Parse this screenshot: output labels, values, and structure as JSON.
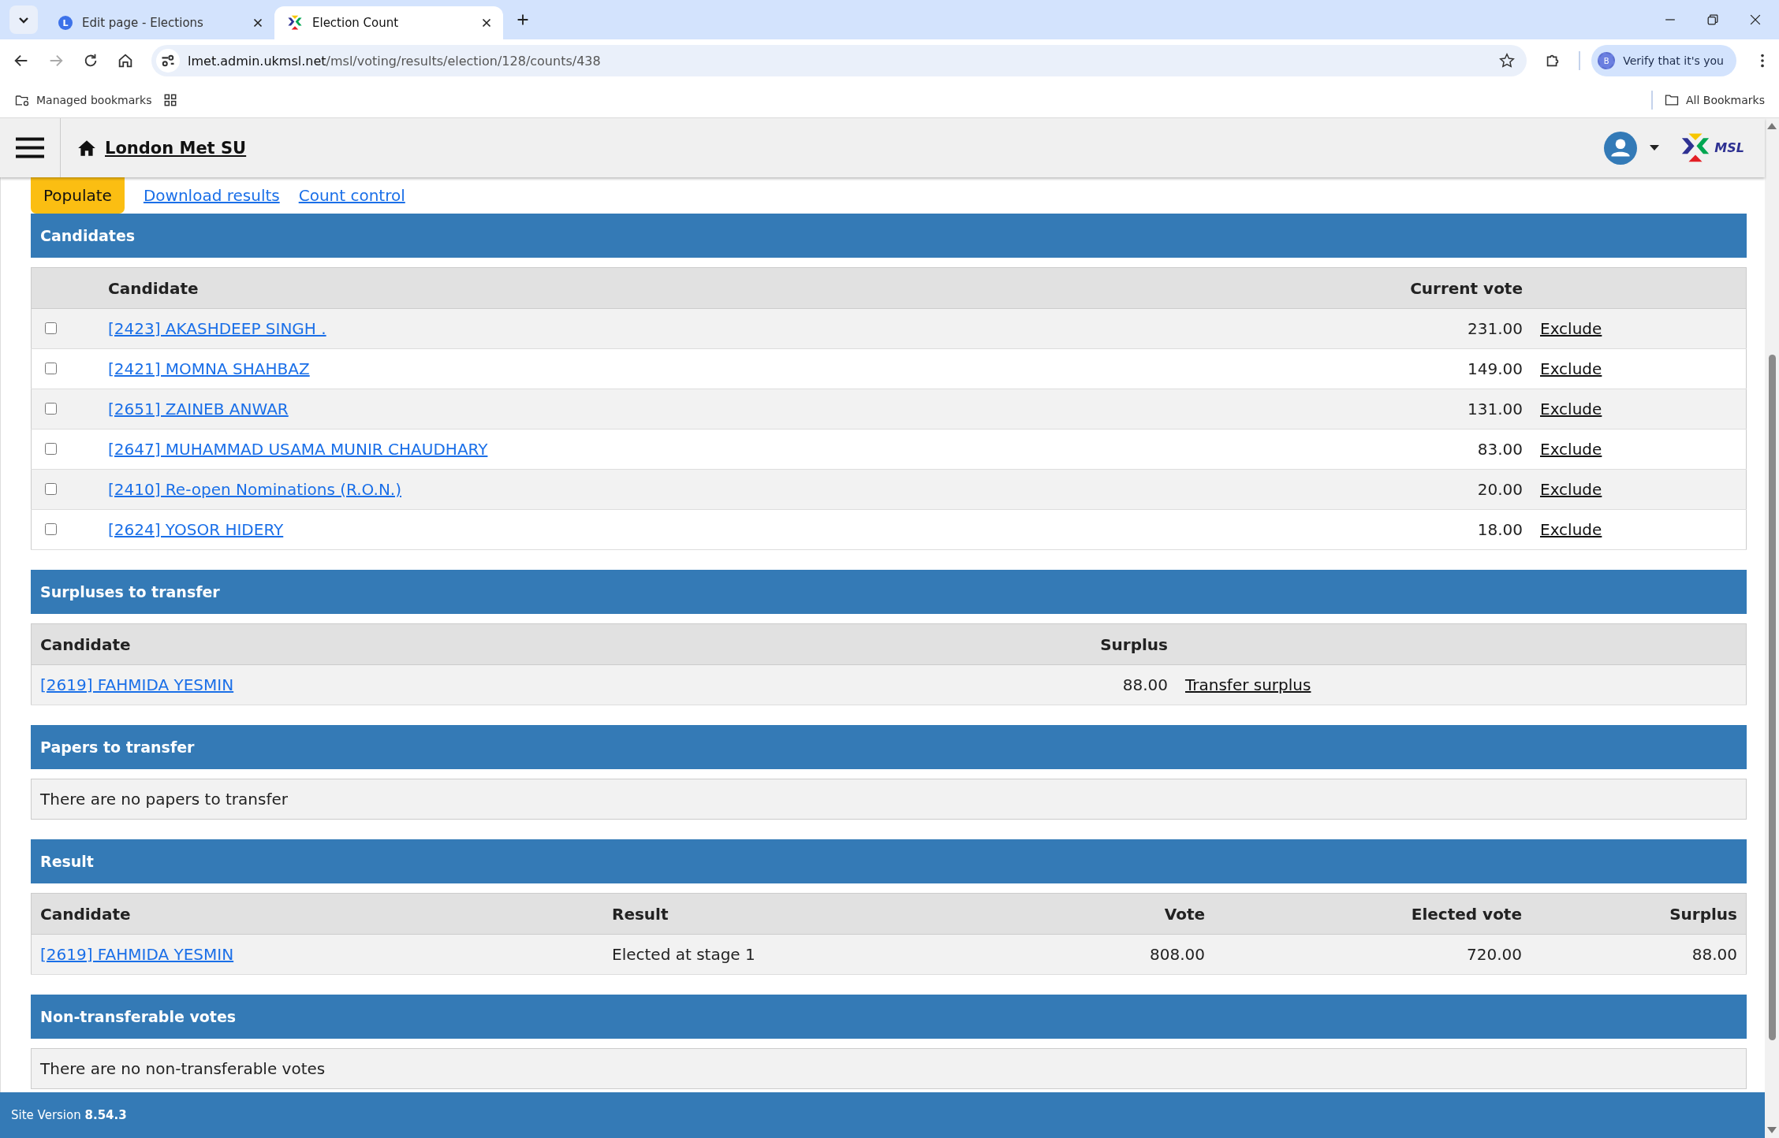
{
  "browser": {
    "tabs": [
      {
        "title": "Edit page - Elections",
        "selected": false,
        "kind": "letter",
        "favicon_text": "L"
      },
      {
        "title": "Election Count",
        "selected": true,
        "kind": "logo"
      }
    ],
    "address": {
      "host": "lmet.admin.ukmsl.net",
      "path": "/msl/voting/results/election/128/counts/438"
    },
    "profile": {
      "initial": "B",
      "label": "Verify that it's you"
    },
    "bookmarks": [
      "Managed bookmarks"
    ],
    "all_bookmarks": "All Bookmarks"
  },
  "header": {
    "site_title": "London Met SU",
    "logo_text": "MSL"
  },
  "actions": [
    {
      "label": "Populate",
      "kind": "button"
    },
    {
      "label": "Download results",
      "kind": "link"
    },
    {
      "label": "Count control",
      "kind": "link"
    }
  ],
  "sections": [
    {
      "title": "Candidates",
      "kind": "candidates",
      "columns": [
        "Candidate",
        "Current vote"
      ],
      "rows": [
        {
          "checked": false,
          "cells": [
            "[2423] AKASHDEEP SINGH .",
            "231.00"
          ],
          "action": "Exclude"
        },
        {
          "checked": false,
          "cells": [
            "[2421] MOMNA SHAHBAZ",
            "149.00"
          ],
          "action": "Exclude"
        },
        {
          "checked": false,
          "cells": [
            "[2651] ZAINEB ANWAR",
            "131.00"
          ],
          "action": "Exclude"
        },
        {
          "checked": false,
          "cells": [
            "[2647] MUHAMMAD USAMA MUNIR CHAUDHARY",
            "83.00"
          ],
          "action": "Exclude"
        },
        {
          "checked": false,
          "cells": [
            "[2410] Re-open Nominations (R.O.N.)",
            "20.00"
          ],
          "action": "Exclude"
        },
        {
          "checked": false,
          "cells": [
            "[2624] YOSOR HIDERY",
            "18.00"
          ],
          "action": "Exclude"
        }
      ]
    },
    {
      "title": "Surpluses to transfer",
      "kind": "surpluses",
      "columns": [
        "Candidate",
        "Surplus"
      ],
      "rows": [
        {
          "cells": [
            "[2619] FAHMIDA YESMIN",
            "88.00"
          ],
          "action": "Transfer surplus"
        }
      ]
    },
    {
      "title": "Papers to transfer",
      "kind": "message",
      "text": "There are no papers to transfer"
    },
    {
      "title": "Result",
      "kind": "result",
      "columns": [
        "Candidate",
        "Result",
        "Vote",
        "Elected vote",
        "Surplus"
      ],
      "rows": [
        {
          "cells": [
            "[2619] FAHMIDA YESMIN",
            "Elected at stage 1",
            "808.00",
            "720.00",
            "88.00"
          ]
        }
      ]
    },
    {
      "title": "Non-transferable votes",
      "kind": "message",
      "text": "There are no non-transferable votes"
    }
  ],
  "footer": {
    "text": "Site Version **8.54.3**"
  }
}
